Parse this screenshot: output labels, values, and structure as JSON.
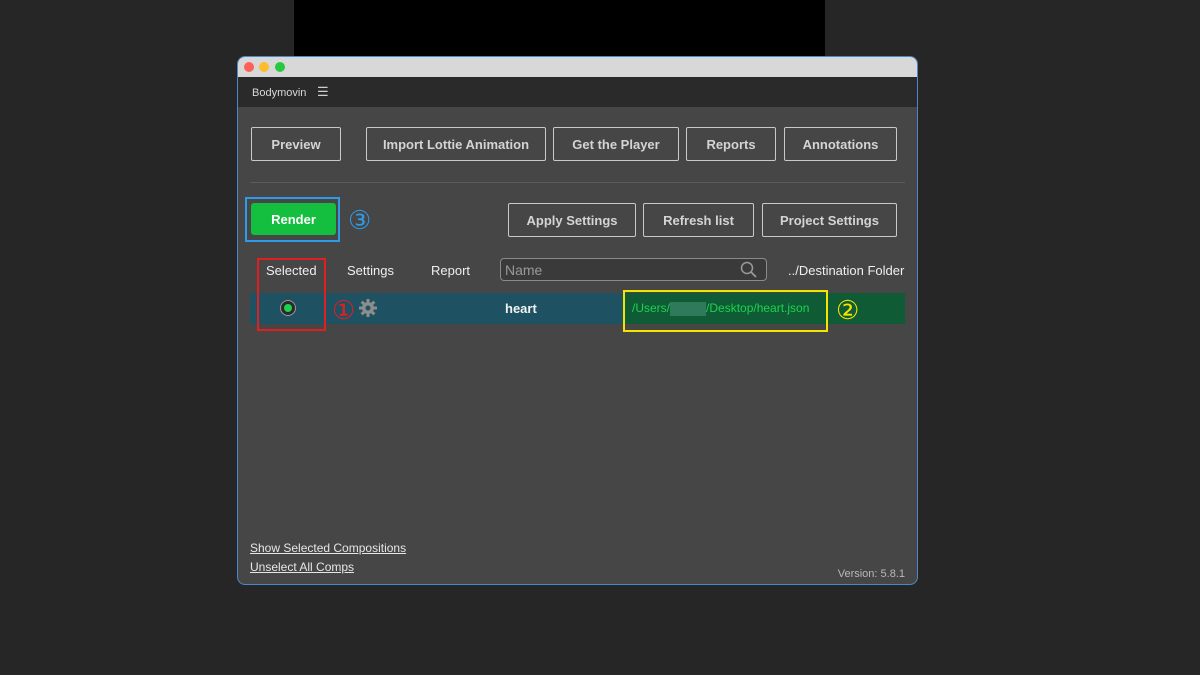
{
  "window": {
    "panel_title": "Bodymovin",
    "menu_icon": "hamburger-menu-icon"
  },
  "toolbar": {
    "preview": "Preview",
    "import_lottie": "Import Lottie Animation",
    "get_player": "Get the Player",
    "reports": "Reports",
    "annotations": "Annotations"
  },
  "actions": {
    "render": "Render",
    "apply_settings": "Apply Settings",
    "refresh_list": "Refresh list",
    "project_settings": "Project Settings"
  },
  "columns": {
    "selected": "Selected",
    "settings": "Settings",
    "report": "Report",
    "search_placeholder": "Name",
    "destination": "../Destination Folder"
  },
  "compositions": [
    {
      "selected": true,
      "name": "heart",
      "destination_prefix": "/Users/",
      "destination_suffix": "/Desktop/heart.json"
    }
  ],
  "annotations": {
    "num1": "①",
    "num1_color": "#e02020",
    "num2": "②",
    "num2_color": "#f5e400",
    "num3": "③",
    "num3_color": "#2f9ae6"
  },
  "footer": {
    "show_selected": "Show Selected Compositions",
    "unselect_all": "Unselect All Comps",
    "version": "Version: 5.8.1"
  },
  "colors": {
    "render_green": "#14bf3f",
    "row_teal": "#1e5161",
    "row_green": "#0e5b36",
    "panel_bg": "#464646"
  }
}
